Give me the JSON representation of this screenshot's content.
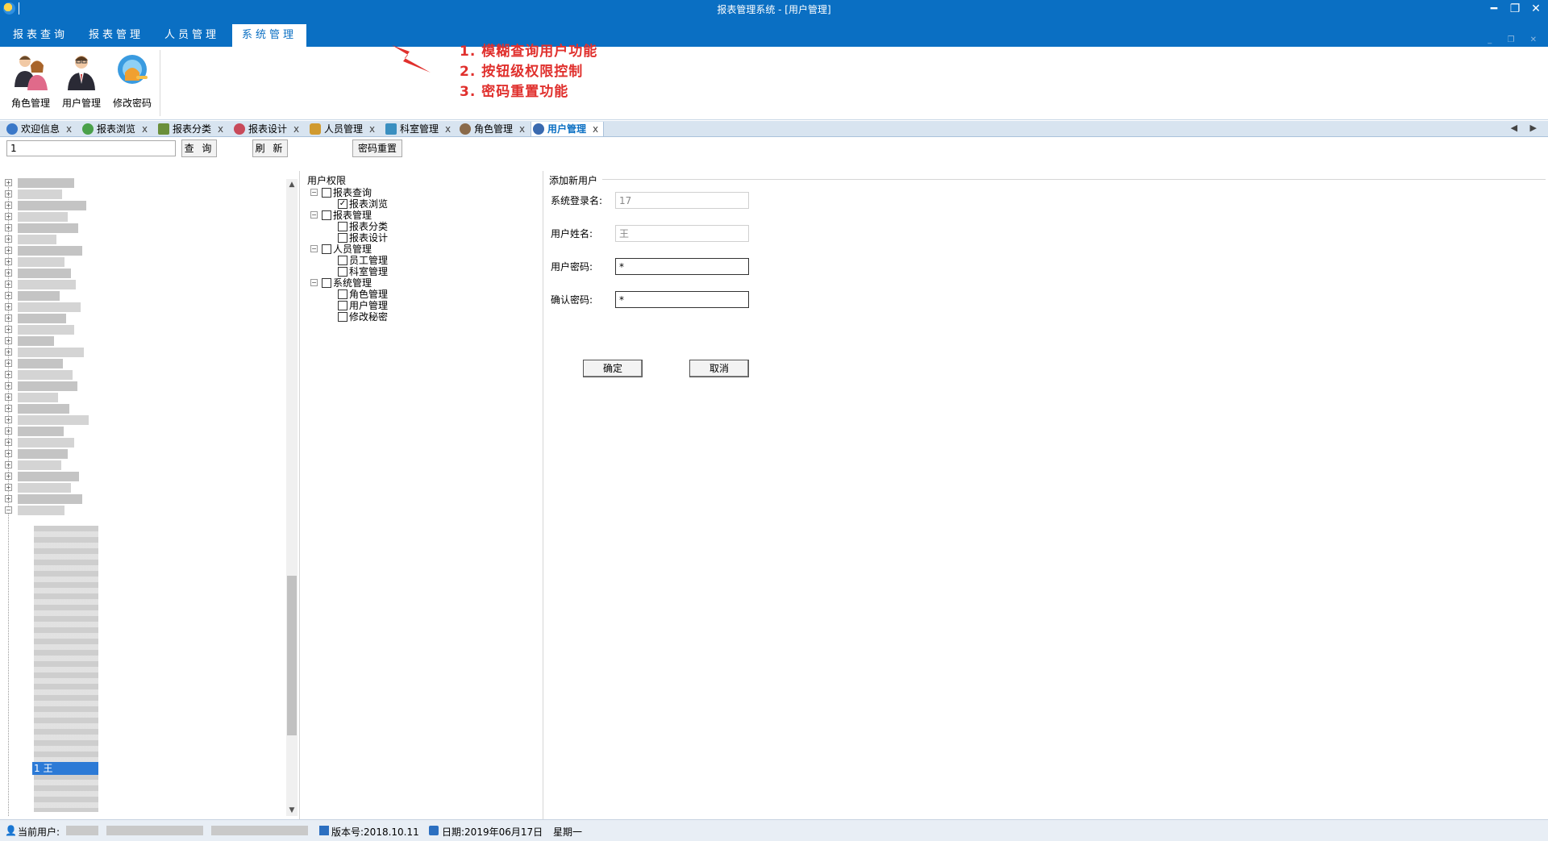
{
  "window": {
    "title": "报表管理系统 - [用户管理]",
    "minimize_glyph": "━",
    "restore_glyph": "❐",
    "close_glyph": "✕"
  },
  "menu": {
    "tabs": [
      {
        "label": "报表查询"
      },
      {
        "label": "报表管理"
      },
      {
        "label": "人员管理"
      },
      {
        "label": "系统管理",
        "active": true
      }
    ],
    "mdi_controls": "_ ❐ ✕"
  },
  "ribbon": {
    "buttons": [
      {
        "label": "角色管理",
        "icon": "role-management-icon"
      },
      {
        "label": "用户管理",
        "icon": "user-management-icon"
      },
      {
        "label": "修改密码",
        "icon": "change-password-icon"
      }
    ],
    "annotations": [
      "1. 模糊查询用户功能",
      "2. 按钮级权限控制",
      "3. 密码重置功能"
    ],
    "annotation_color": "#e0302d"
  },
  "doc_tabs": [
    {
      "label": "欢迎信息",
      "close": "x",
      "icon_color": "#3a78c8"
    },
    {
      "label": "报表浏览",
      "close": "x",
      "icon_color": "#4aa04a"
    },
    {
      "label": "报表分类",
      "close": "x",
      "icon_color": "#6a8f3a"
    },
    {
      "label": "报表设计",
      "close": "x",
      "icon_color": "#c84a5a"
    },
    {
      "label": "人员管理",
      "close": "x",
      "icon_color": "#d09a30"
    },
    {
      "label": "科室管理",
      "close": "x",
      "icon_color": "#3a8fc0"
    },
    {
      "label": "角色管理",
      "close": "x",
      "icon_color": "#8a6a4a"
    },
    {
      "label": "用户管理",
      "close": "x",
      "icon_color": "#3a6ab0",
      "active": true
    }
  ],
  "tab_arrows": "◀ ▶",
  "toolbar": {
    "search_value": "1",
    "query_label": "查 询",
    "refresh_label": "刷 新",
    "reset_password_label": "密码重置"
  },
  "left_tree": {
    "selected_node_text": "1 王"
  },
  "permissions": {
    "title": "用户权限",
    "groups": [
      {
        "label": "报表查询",
        "checked": false,
        "children": [
          {
            "label": "报表浏览",
            "checked": true
          }
        ]
      },
      {
        "label": "报表管理",
        "checked": false,
        "children": [
          {
            "label": "报表分类",
            "checked": false
          },
          {
            "label": "报表设计",
            "checked": false
          }
        ]
      },
      {
        "label": "人员管理",
        "checked": false,
        "children": [
          {
            "label": "员工管理",
            "checked": false
          },
          {
            "label": "科室管理",
            "checked": false
          }
        ]
      },
      {
        "label": "系统管理",
        "checked": false,
        "children": [
          {
            "label": "角色管理",
            "checked": false
          },
          {
            "label": "用户管理",
            "checked": false
          },
          {
            "label": "修改秘密",
            "checked": false
          }
        ]
      }
    ]
  },
  "form": {
    "title": "添加新用户",
    "login_label": "系统登录名:",
    "login_value": "17",
    "name_label": "用户姓名:",
    "name_value": "王",
    "password_label": "用户密码:",
    "password_value": "*",
    "confirm_label": "确认密码:",
    "confirm_value": "*",
    "ok_label": "确定",
    "cancel_label": "取消"
  },
  "status": {
    "current_user_label": "当前用户:",
    "version": "版本号:2018.10.11",
    "date": "日期:2019年06月17日",
    "weekday": "星期一"
  }
}
